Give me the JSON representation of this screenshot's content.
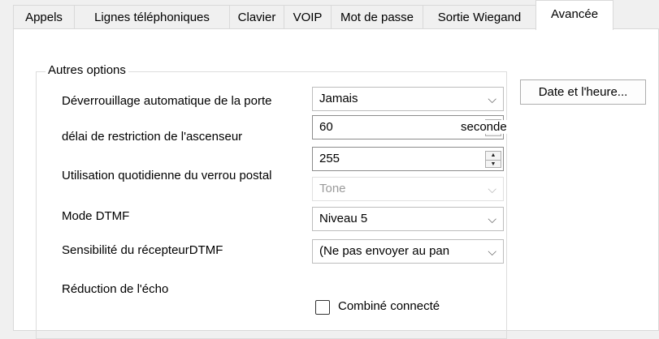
{
  "tabs": [
    {
      "label": "Appels"
    },
    {
      "label": "Lignes téléphoniques"
    },
    {
      "label": "Clavier"
    },
    {
      "label": "VOIP"
    },
    {
      "label": "Mot de passe"
    },
    {
      "label": "Sortie Wiegand"
    },
    {
      "label": "Avancée",
      "active": true
    }
  ],
  "group": {
    "title": "Autres options"
  },
  "fields": {
    "auto_unlock_label": "Déverrouillage automatique de la porte",
    "auto_unlock_value": "Jamais",
    "elevator_delay_label": "délai de restriction de l'ascenseur",
    "elevator_delay_value": "60",
    "elevator_delay_unit": "seconde",
    "mailbox_label": "Utilisation quotidienne du verrou postal",
    "mailbox_value": "255",
    "disabled_select_value": "Tone",
    "dtmf_mode_label": "Mode DTMF",
    "dtmf_mode_value": "Niveau 5",
    "dtmf_sensitivity_label": "Sensibilité du récepteurDTMF",
    "dtmf_sensitivity_value": "(Ne pas envoyer au pan",
    "echo_label": "Réduction de l'écho",
    "handset_label": "Combiné connecté",
    "handset_checked": false
  },
  "buttons": {
    "datetime": "Date et l'heure..."
  },
  "icons": {
    "dropdown": "chevron-down-icon",
    "spin": "spin-arrows-icon"
  }
}
